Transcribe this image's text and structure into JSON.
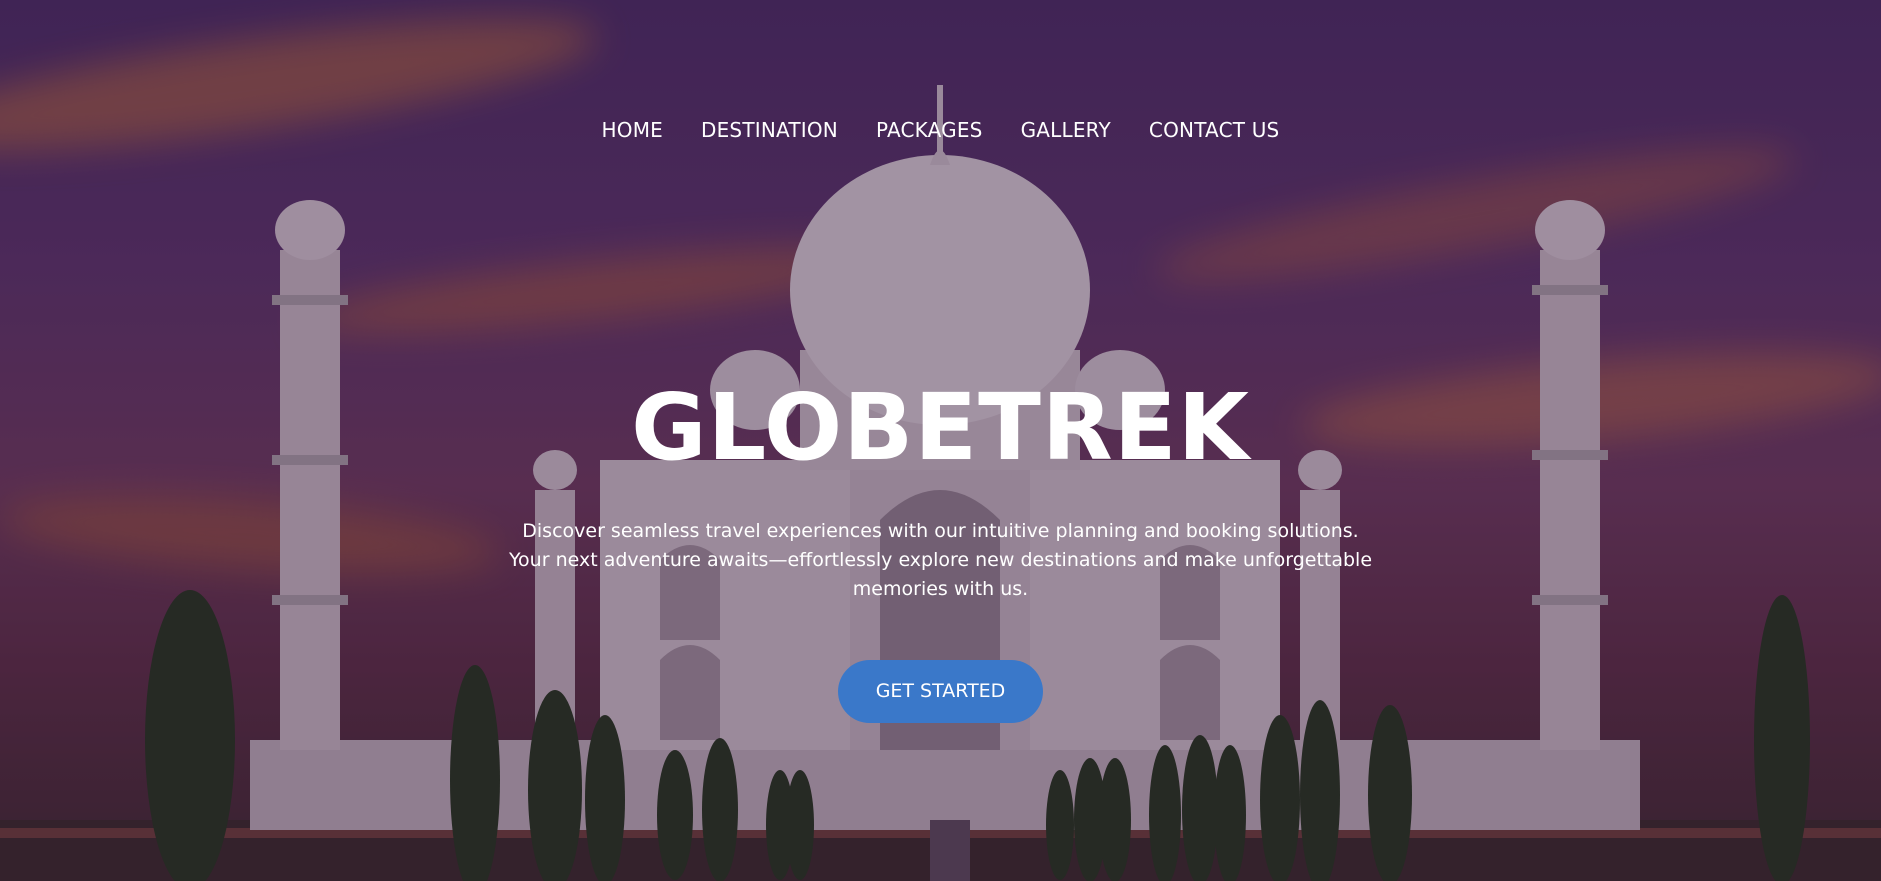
{
  "colors": {
    "cta_background": "#3a78c9",
    "text": "#ffffff",
    "overlay": "#4a2d63"
  },
  "hero_image": {
    "subject-icon": "taj-mahal-sunset-photo"
  },
  "nav": {
    "items": [
      {
        "label": "HOME"
      },
      {
        "label": "DESTINATION"
      },
      {
        "label": "PACKAGES"
      },
      {
        "label": "GALLERY"
      },
      {
        "label": "CONTACT US"
      }
    ]
  },
  "hero": {
    "title": "GLOBETREK",
    "tagline": "Discover seamless travel experiences with our intuitive planning and booking solutions. Your next adventure awaits—effortlessly explore new destinations and make unforgettable memories with us.",
    "cta_label": "GET STARTED"
  }
}
